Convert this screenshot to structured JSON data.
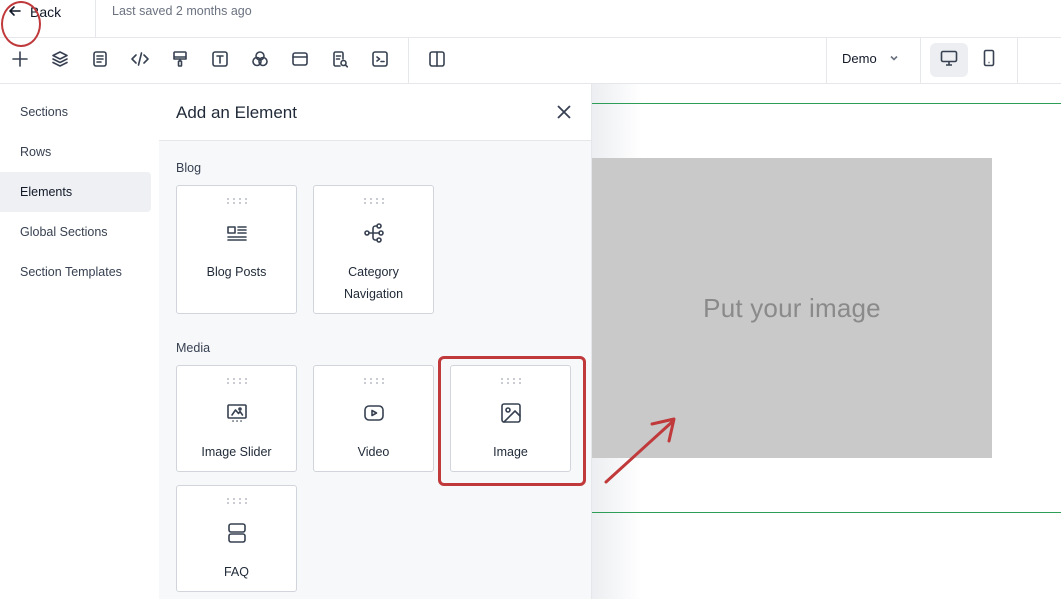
{
  "topbar": {
    "back_label": "Back",
    "saved_text": "Last saved 2 months ago"
  },
  "toolbar": {
    "tools": [
      "add-icon",
      "layers-icon",
      "page-icon",
      "code-icon",
      "paint-roller-icon",
      "text-icon",
      "color-circles-icon",
      "browser-window-icon",
      "page-search-icon",
      "terminal-icon",
      "split-view-icon"
    ],
    "site_select": "Demo",
    "devices": [
      "desktop-icon",
      "mobile-icon"
    ]
  },
  "sidenav": {
    "items": [
      {
        "label": "Sections"
      },
      {
        "label": "Rows"
      },
      {
        "label": "Elements"
      },
      {
        "label": "Global Sections"
      },
      {
        "label": "Section Templates"
      }
    ]
  },
  "panel": {
    "title": "Add an Element",
    "groups": [
      {
        "label": "Blog",
        "cards": [
          {
            "label": "Blog Posts",
            "icon": "blog-posts-icon"
          },
          {
            "label": "Category Navigation",
            "icon": "category-tree-icon"
          }
        ]
      },
      {
        "label": "Media",
        "cards": [
          {
            "label": "Image Slider",
            "icon": "image-slider-icon"
          },
          {
            "label": "Video",
            "icon": "video-icon"
          },
          {
            "label": "Image",
            "icon": "image-icon"
          },
          {
            "label": "FAQ",
            "icon": "faq-icon"
          }
        ]
      }
    ]
  },
  "canvas": {
    "placeholder_text": "Put your image"
  },
  "colors": {
    "highlight": "#c0393b",
    "guide_line": "#2e9e57",
    "placeholder_bg": "#c9c9c9"
  }
}
